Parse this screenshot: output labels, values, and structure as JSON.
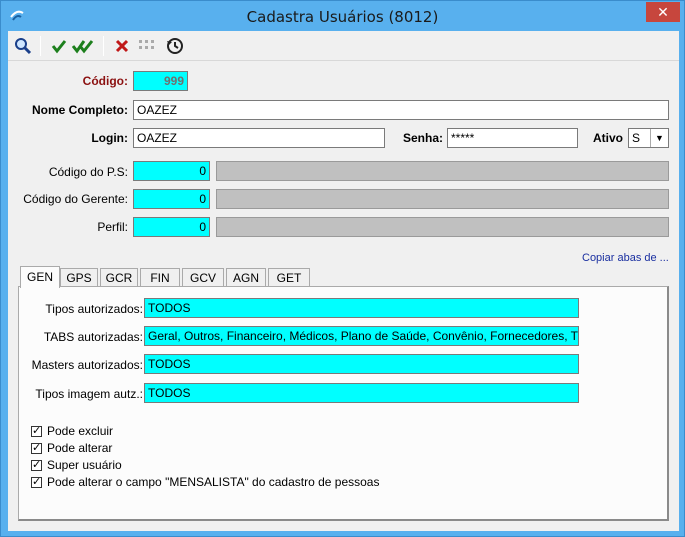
{
  "window": {
    "title": "Cadastra Usuários (8012)",
    "close_glyph": "✕"
  },
  "toolbar": {
    "search": "search-icon",
    "confirm": "check-icon",
    "confirm_all": "double-check-icon",
    "cancel": "x-icon",
    "disabled": "grid-icon",
    "history": "history-icon"
  },
  "form": {
    "codigo_label": "Código:",
    "codigo_value": "999",
    "nome_label": "Nome Completo:",
    "nome_value": "OAZEZ",
    "login_label": "Login:",
    "login_value": "OAZEZ",
    "senha_label": "Senha:",
    "senha_value": "*****",
    "ativo_label": "Ativo",
    "ativo_value": "S",
    "ps_label": "Código do P.S:",
    "ps_value": "0",
    "gerente_label": "Código do Gerente:",
    "gerente_value": "0",
    "perfil_label": "Perfil:",
    "perfil_value": "0",
    "copy_link": "Copiar abas de ..."
  },
  "tabs": [
    "GEN",
    "GPS",
    "GCR",
    "FIN",
    "GCV",
    "AGN",
    "GET"
  ],
  "gen": {
    "tipos_label": "Tipos autorizados:",
    "tipos_value": "TODOS",
    "tabs_label": "TABS autorizadas:",
    "tabs_value": "Geral, Outros, Financeiro, Médicos, Plano de Saúde, Convênio, Fornecedores, T",
    "masters_label": "Masters autorizados:",
    "masters_value": "TODOS",
    "imagem_label": "Tipos imagem autz.:",
    "imagem_value": "TODOS",
    "checks": [
      {
        "label": "Pode excluir",
        "checked": true
      },
      {
        "label": "Pode alterar",
        "checked": true
      },
      {
        "label": "Super usuário",
        "checked": true
      },
      {
        "label": "Pode alterar o campo \"MENSALISTA\" do cadastro de pessoas",
        "checked": true
      }
    ]
  },
  "colors": {
    "cyan": "#00ffff",
    "title_bar": "#58b0ee",
    "close": "#c7463d"
  }
}
